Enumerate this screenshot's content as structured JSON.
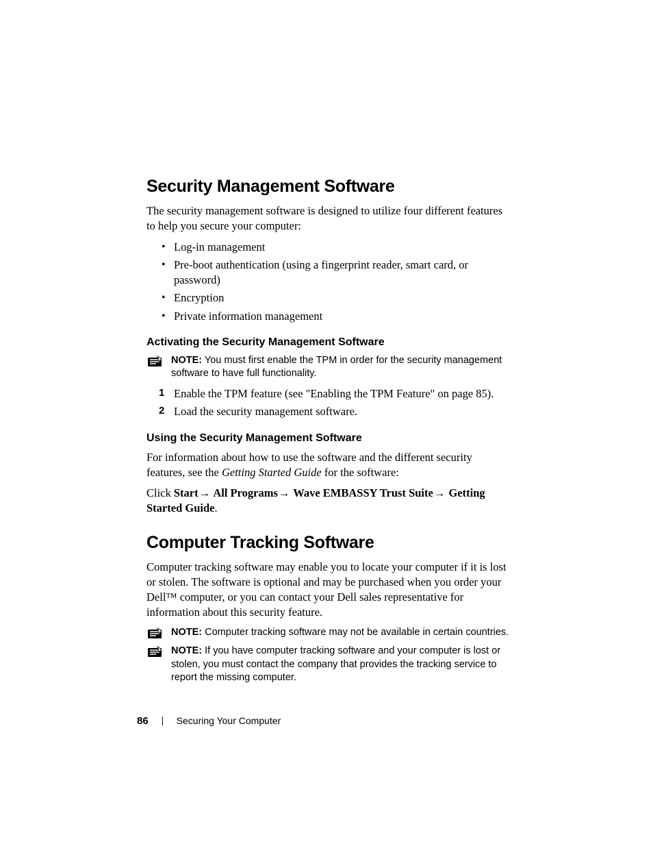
{
  "section1": {
    "heading": "Security Management Software",
    "intro": "The security management software is designed to utilize four different features to help you secure your computer:",
    "bullets": [
      "Log-in management",
      "Pre-boot authentication (using a fingerprint reader, smart card, or password)",
      "Encryption",
      "Private information management"
    ],
    "subA": {
      "heading": "Activating the Security Management Software",
      "note_label": "NOTE:",
      "note_text": " You must first enable the TPM in order for the security management software to have full functionality.",
      "steps": [
        "Enable the TPM feature (see \"Enabling the TPM Feature\" on page 85).",
        "Load the security management software."
      ]
    },
    "subB": {
      "heading": "Using the Security Management Software",
      "para_lead": "For information about how to use the software and the different security features, see the ",
      "para_italic": "Getting Started Guide",
      "para_tail": " for the software:",
      "click_word": "Click ",
      "path": [
        "Start",
        "All Programs",
        "Wave EMBASSY Trust Suite",
        "Getting Started Guide"
      ],
      "arrow": "→",
      "period": "."
    }
  },
  "section2": {
    "heading": "Computer Tracking Software",
    "para": "Computer tracking software may enable you to locate your computer if it is lost or stolen. The software is optional and may be purchased when you order your Dell™ computer, or you can contact your Dell sales representative for information about this security feature.",
    "note1_label": "NOTE:",
    "note1_text": " Computer tracking software may not be available in certain countries.",
    "note2_label": "NOTE:",
    "note2_text": " If you have computer tracking software and your computer is lost or stolen, you must contact the company that provides the tracking service to report the missing computer."
  },
  "footer": {
    "page": "86",
    "chapter": "Securing Your Computer"
  }
}
